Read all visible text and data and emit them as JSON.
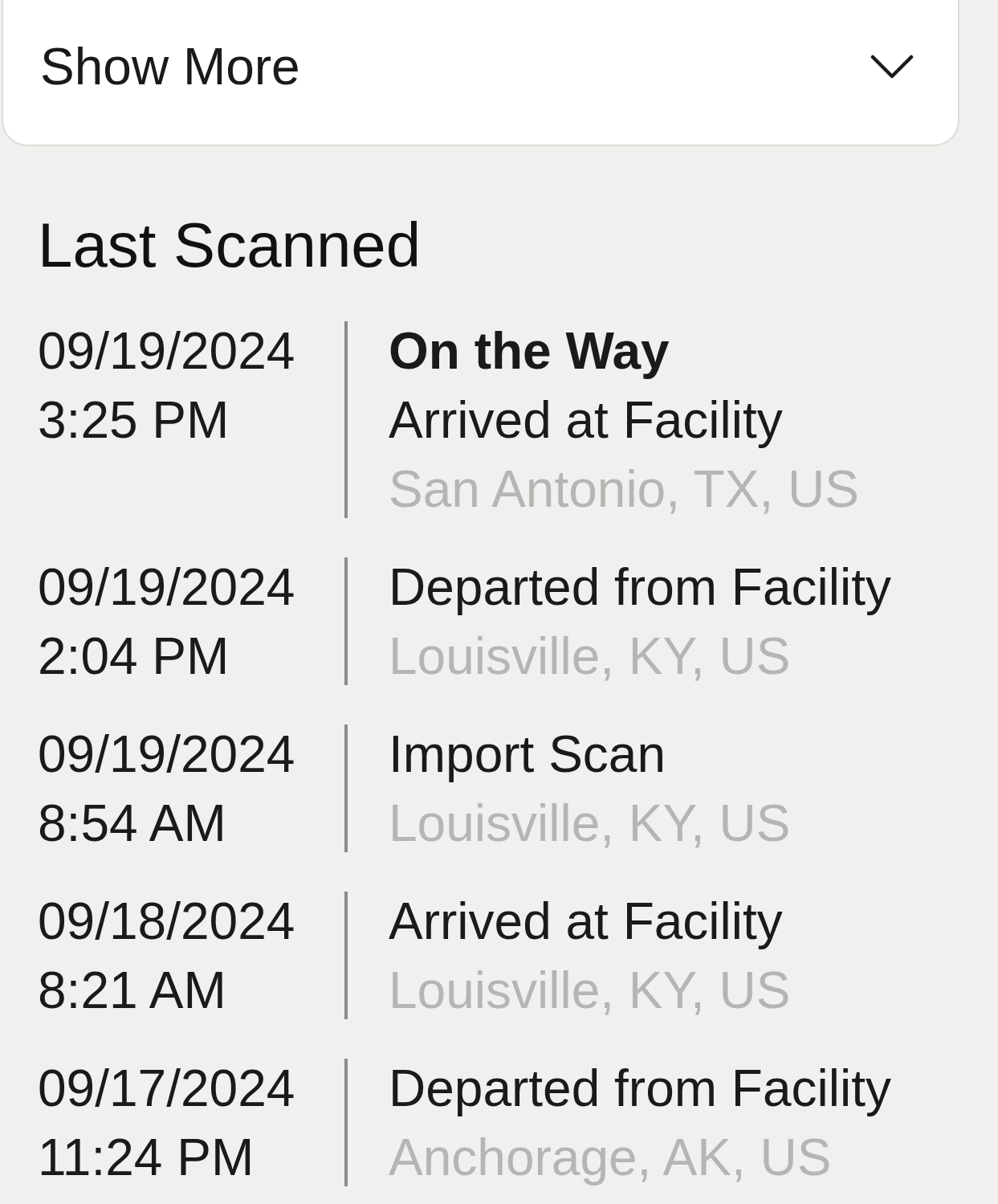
{
  "show_more": {
    "label": "Show More",
    "expanded": false
  },
  "section_title": "Last Scanned",
  "scans": [
    {
      "date": "09/19/2024",
      "time": "3:25 PM",
      "status": "On the Way",
      "event": "Arrived at Facility",
      "location": "San Antonio, TX, US"
    },
    {
      "date": "09/19/2024",
      "time": "2:04 PM",
      "event": "Departed from Facility",
      "location": "Louisville, KY, US"
    },
    {
      "date": "09/19/2024",
      "time": "8:54 AM",
      "event": "Import Scan",
      "location": "Louisville, KY, US"
    },
    {
      "date": "09/18/2024",
      "time": "8:21 AM",
      "event": "Arrived at Facility",
      "location": "Louisville, KY, US"
    },
    {
      "date": "09/17/2024",
      "time": "11:24 PM",
      "event": "Departed from Facility",
      "location": "Anchorage, AK, US"
    }
  ]
}
